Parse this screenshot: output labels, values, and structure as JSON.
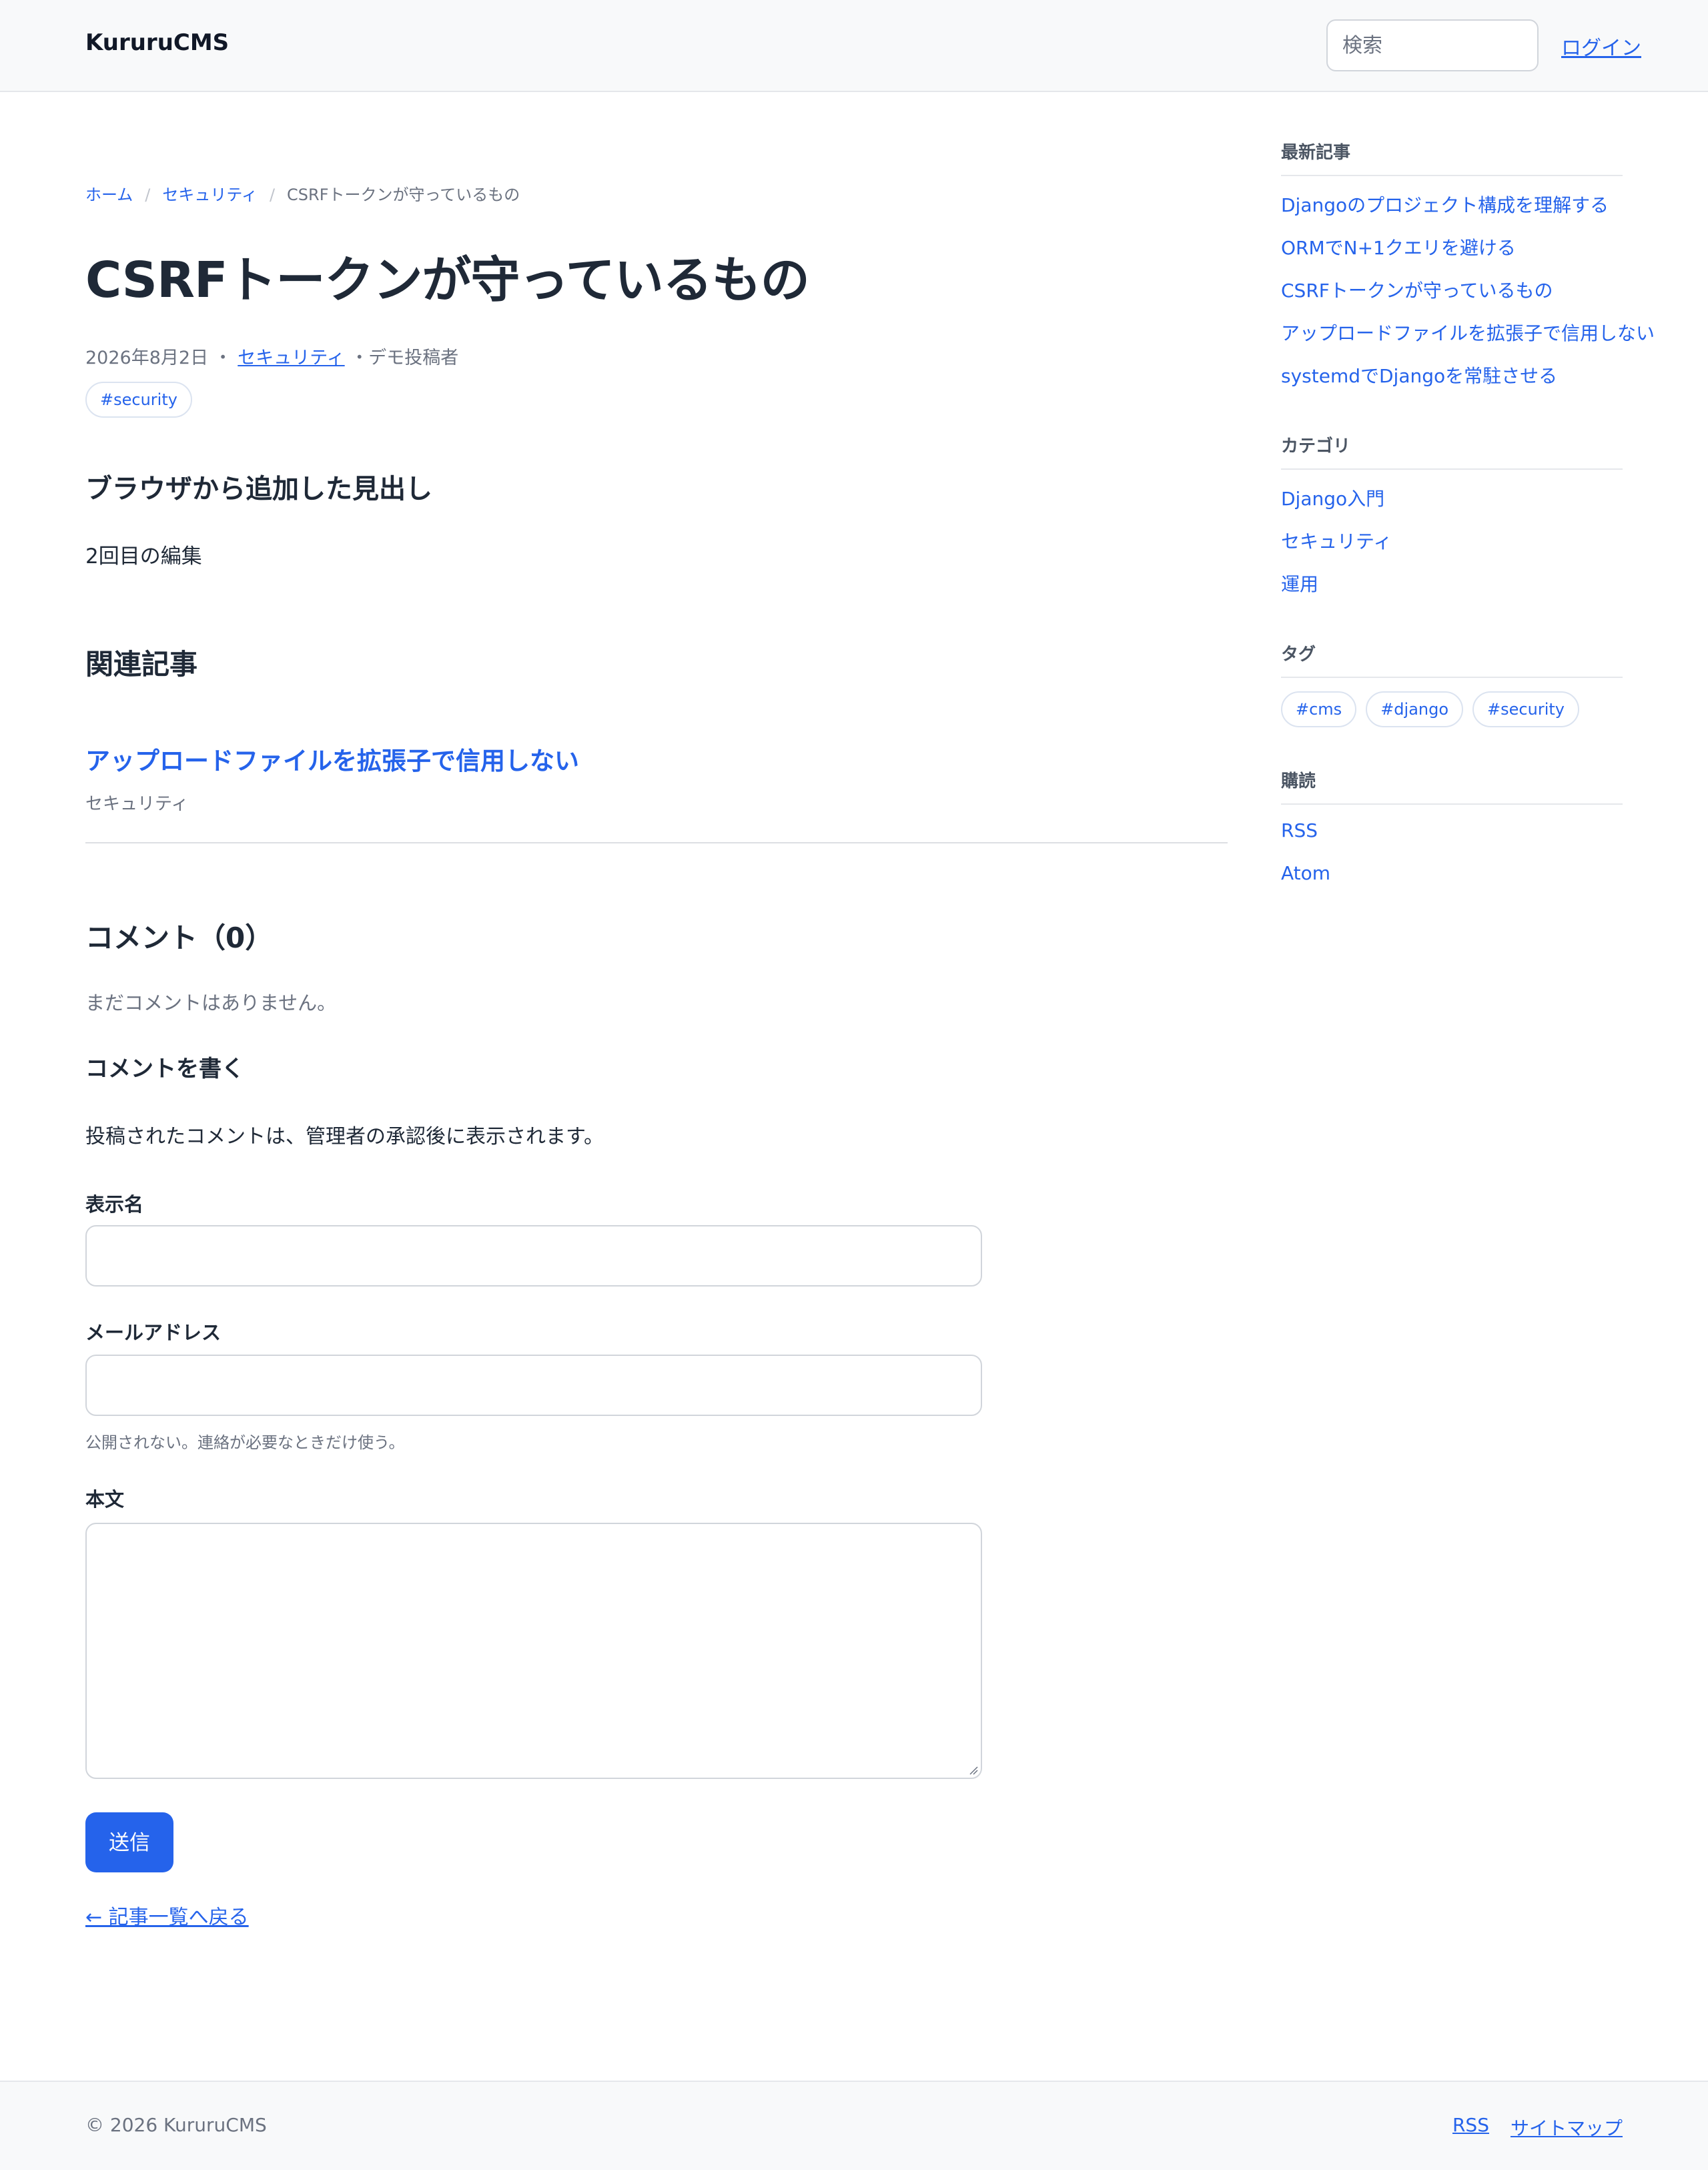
{
  "header": {
    "brand": "KururuCMS",
    "search_placeholder": "検索",
    "login_label": "ログイン"
  },
  "breadcrumb": {
    "items": [
      "ホーム",
      "セキュリティ",
      "CSRFトークンが守っているもの"
    ]
  },
  "post": {
    "title": "CSRFトークンが守っているもの",
    "date": "2026年8月2日",
    "category": "セキュリティ",
    "author": "デモ投稿者",
    "tags": [
      "#security"
    ],
    "body_heading": "ブラウザから追加した見出し",
    "body_text": "2回目の編集"
  },
  "related": {
    "heading": "関連記事",
    "items": [
      {
        "title": "アップロードファイルを拡張子で信用しない",
        "category": "セキュリティ"
      }
    ]
  },
  "comments": {
    "heading": "コメント（0）",
    "empty_text": "まだコメントはありません。",
    "form_heading": "コメントを書く",
    "form_note": "投稿されたコメントは、管理者の承認後に表示されます。",
    "name_label": "表示名",
    "name_value": "",
    "email_label": "メールアドレス",
    "email_value": "",
    "email_help": "公開されない。連絡が必要なときだけ使う。",
    "body_label": "本文",
    "body_value": "",
    "submit_label": "送信"
  },
  "back_link": "← 記事一覧へ戻る",
  "sidebar": {
    "recent_title": "最新記事",
    "recent_posts": [
      "Djangoのプロジェクト構成を理解する",
      "ORMでN+1クエリを避ける",
      "CSRFトークンが守っているもの",
      "アップロードファイルを拡張子で信用しない",
      "systemdでDjangoを常駐させる"
    ],
    "categories_title": "カテゴリ",
    "categories": [
      "Django入門",
      "セキュリティ",
      "運用"
    ],
    "tags_title": "タグ",
    "tags": [
      "#cms",
      "#django",
      "#security"
    ],
    "subscribe_title": "購読",
    "feeds": [
      "RSS",
      "Atom"
    ]
  },
  "footer": {
    "copyright": "© 2026 KururuCMS",
    "links": [
      "RSS",
      "サイトマップ"
    ]
  },
  "colors": {
    "accent": "#2563eb",
    "text": "#1f2937",
    "muted": "#6b7280",
    "header_bg": "#f8f9fa"
  }
}
